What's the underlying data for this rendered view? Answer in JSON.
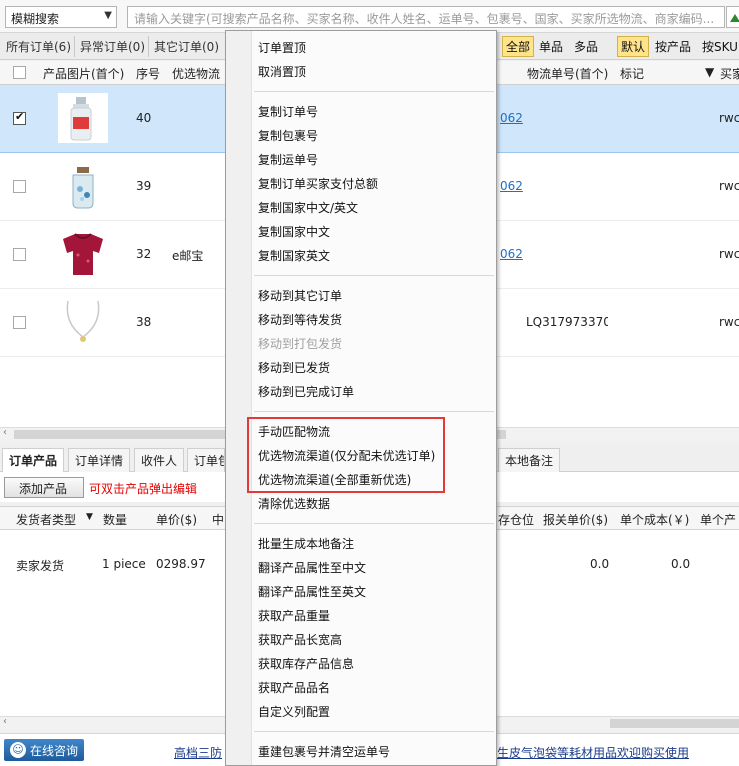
{
  "search": {
    "mode": "模糊搜索",
    "placeholder": "请输入关键字(可搜索产品名称、买家名称、收件人姓名、运单号、包裹号、国家、买家所选物流、商家编码..."
  },
  "order_tabs": [
    {
      "label": "所有订单(6)"
    },
    {
      "label": "异常订单(0)"
    },
    {
      "label": "其它订单(0)"
    }
  ],
  "filters": {
    "all": "全部",
    "single": "单品",
    "multi": "多品",
    "default": "默认",
    "by_product": "按产品",
    "by_sku": "按SKU"
  },
  "grid": {
    "headers": {
      "image": "产品图片(首个)",
      "seq": "序号",
      "logistics": "优选物流",
      "tracking": "物流单号(首个)",
      "mark": "标记",
      "buyer": "买家"
    },
    "rows": [
      {
        "seq": "40",
        "logistics": "",
        "link": "062",
        "tracking": "",
        "buyer": "rwc",
        "checked": true,
        "img": "spray-bottle-icon"
      },
      {
        "seq": "39",
        "logistics": "",
        "link": "062",
        "tracking": "",
        "buyer": "rwc",
        "checked": false,
        "img": "glass-jar-icon"
      },
      {
        "seq": "32",
        "logistics": "e邮宝",
        "link": "062",
        "tracking": "",
        "buyer": "rwc",
        "checked": false,
        "img": "red-shirt-icon"
      },
      {
        "seq": "38",
        "logistics": "",
        "link": "",
        "tracking": "LQ3179733700",
        "buyer": "rwc",
        "checked": false,
        "img": "necklace-icon"
      }
    ]
  },
  "bottom_tabs": [
    {
      "label": "订单产品"
    },
    {
      "label": "订单详情"
    },
    {
      "label": "收件人"
    },
    {
      "label": "订单包"
    },
    {
      "label": "本地备注"
    }
  ],
  "product_toolbar": {
    "add_label": "添加产品",
    "hint": "可双击产品弹出编辑"
  },
  "product_grid": {
    "headers": {
      "shipper_type": "发货者类型",
      "qty": "数量",
      "unit_price": "单价($)",
      "mid": "中",
      "warehouse": "存仓位",
      "customs_price": "报关单价($)",
      "unit_cost": "单个成本(￥)",
      "unit_prod": "单个产"
    },
    "row": {
      "shipper_type": "卖家发货",
      "qty": "1 piece",
      "unit_price": "0298.97",
      "customs_price": "0.0",
      "unit_cost": "0.0"
    }
  },
  "footer": {
    "chat": "在线咨询",
    "ticker_left": "高档三防",
    "ticker_right": "生皮气泡袋等耗材用品欢迎购买使用"
  },
  "context_menu": {
    "group1": [
      "订单置顶",
      "取消置顶"
    ],
    "group2": [
      "复制订单号",
      "复制包裹号",
      "复制运单号",
      "复制订单买家支付总额",
      "复制国家中文/英文",
      "复制国家中文",
      "复制国家英文"
    ],
    "group3": [
      "移动到其它订单",
      "移动到等待发货",
      "移动到打包发货",
      "移动到已发货",
      "移动到已完成订单"
    ],
    "group4": [
      "手动匹配物流",
      "优选物流渠道(仅分配未优选订单)",
      "优选物流渠道(全部重新优选)",
      "清除优选数据"
    ],
    "group5": [
      "批量生成本地备注",
      "翻译产品属性至中文",
      "翻译产品属性至英文",
      "获取产品重量",
      "获取产品长宽高",
      "获取库存产品信息",
      "获取产品品名",
      "自定义列配置"
    ],
    "group6": [
      "重建包裹号并清空运单号"
    ],
    "disabled_item": "移动到打包发货"
  },
  "colors": {
    "selected_row": "#cfe6fb",
    "highlight_box": "#e23a3a",
    "filter_active": "#ffe48a",
    "link": "#1f6fc7",
    "hint": "#e60000"
  }
}
